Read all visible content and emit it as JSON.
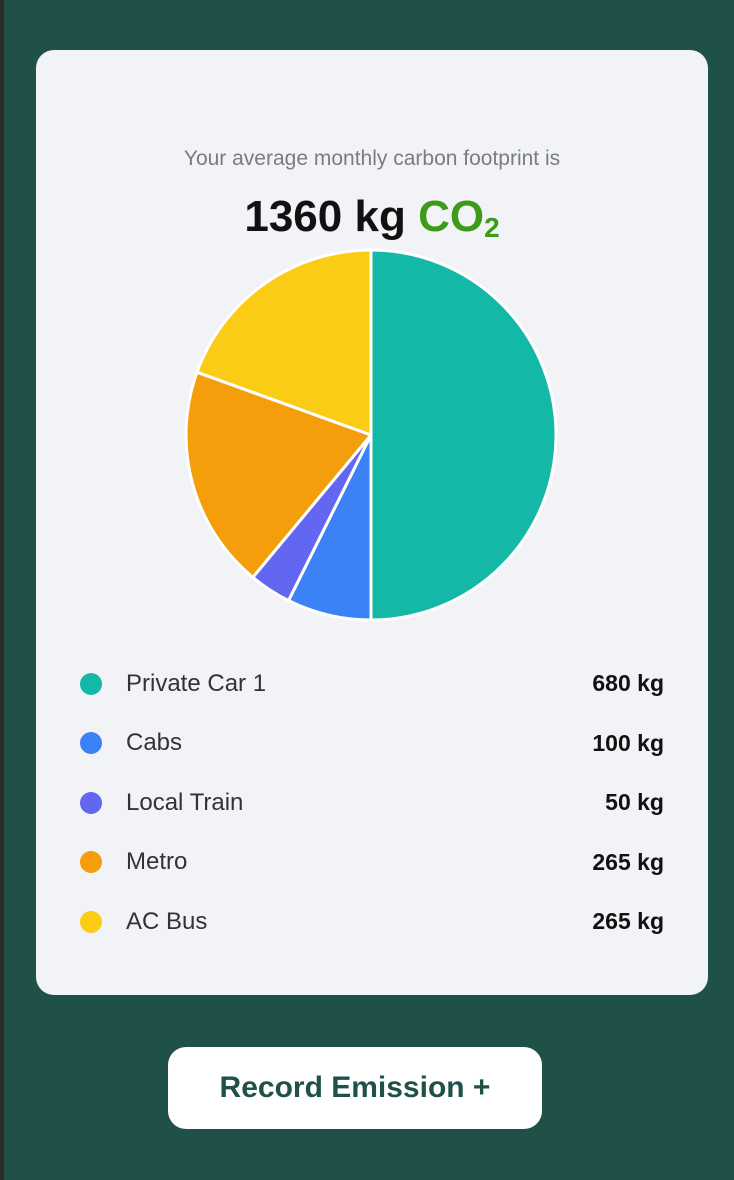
{
  "summary": {
    "subtitle": "Your average monthly carbon footprint is",
    "amount": "1360 kg",
    "gas_main": "CO",
    "gas_sub": "2"
  },
  "chart_data": {
    "type": "pie",
    "categories": [
      "Private Car 1",
      "Cabs",
      "Local Train",
      "Metro",
      "AC Bus"
    ],
    "values": [
      680,
      100,
      50,
      265,
      265
    ],
    "unit": "kg",
    "colors": [
      "#14b8a6",
      "#3b82f6",
      "#6366f1",
      "#f59e0b",
      "#facc15"
    ]
  },
  "legend": [
    {
      "name": "Private Car 1",
      "value": "680 kg",
      "color": "#14b8a6"
    },
    {
      "name": "Cabs",
      "value": "100 kg",
      "color": "#3b82f6"
    },
    {
      "name": "Local Train",
      "value": "50 kg",
      "color": "#6366f1"
    },
    {
      "name": "Metro",
      "value": "265 kg",
      "color": "#f59e0b"
    },
    {
      "name": "AC Bus",
      "value": "265 kg",
      "color": "#facc15"
    }
  ],
  "actions": {
    "record_label": "Record Emission +"
  }
}
